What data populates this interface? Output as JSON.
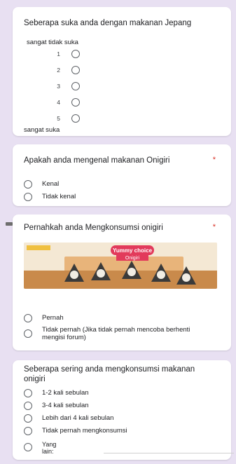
{
  "colors": {
    "page_bg": "#e8e0f2",
    "card_bg": "#ffffff",
    "required": "#d93025",
    "radio": "#5f6368"
  },
  "q1": {
    "title": "Seberapa suka anda dengan makanan Jepang",
    "low_label": "sangat tidak suka",
    "high_label": "sangat suka",
    "scale": [
      "1",
      "2",
      "3",
      "4",
      "5"
    ]
  },
  "q2": {
    "title": "Apakah anda mengenal makanan Onigiri",
    "required_mark": "*",
    "options": [
      "Kenal",
      "Tidak kenal"
    ]
  },
  "q3": {
    "title": "Pernahkah anda Mengkonsumsi onigiri",
    "required_mark": "*",
    "image": {
      "brand_line1": "Yummy",
      "brand_line2": "choice",
      "product_label": "Onigiri"
    },
    "options": [
      "Pernah",
      "Tidak pernah (Jika tidak pernah mencoba berhenti mengisi forum)"
    ]
  },
  "q4": {
    "title": "Seberapa sering anda mengkonsumsi makanan  onigiri",
    "options": [
      "1-2 kali sebulan",
      "3-4 kali sebulan",
      "Lebih dari 4 kali sebulan",
      "Tidak pernah mengkonsumsi"
    ],
    "other_label": "Yang lain:"
  }
}
